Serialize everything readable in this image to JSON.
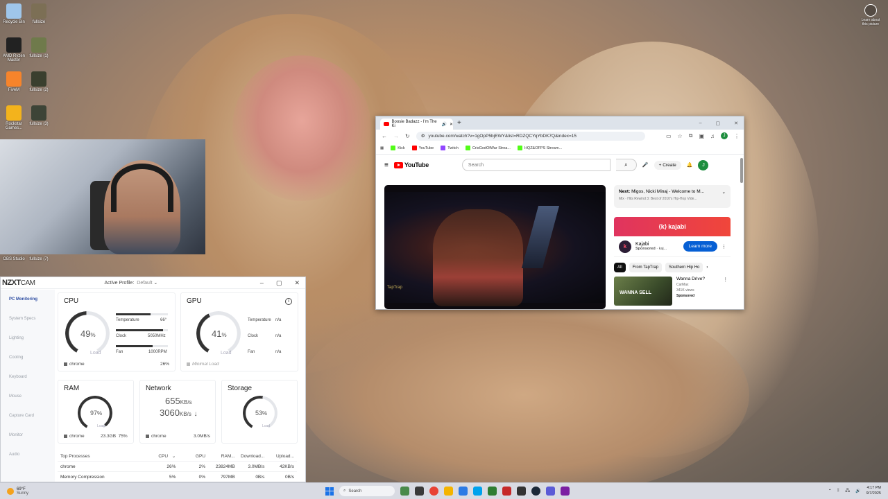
{
  "desktop": {
    "icons": [
      {
        "label": "Recycle Bin",
        "color": "#9fc6ea"
      },
      {
        "label": "fullsize",
        "color": "#7c6f55"
      },
      {
        "label": "AMD Ryzen Master",
        "color": "#222222"
      },
      {
        "label": "fullsize (1)",
        "color": "#6f7a4b"
      },
      {
        "label": "FiveM",
        "color": "#f7842b"
      },
      {
        "label": "fullsize (2)",
        "color": "#3a3f2e"
      },
      {
        "label": "Rockstar Games...",
        "color": "#f3b31c"
      },
      {
        "label": "fullsize (3)",
        "color": "#3d4437"
      },
      {
        "label": "OBS Studio",
        "color": "#2b2b2b"
      },
      {
        "label": "fullsize (7)",
        "color": "#585048"
      }
    ],
    "learn_picture": "Learn about this picture"
  },
  "nzxt": {
    "logo": "NZXT",
    "logo_sub": "CAM",
    "profile_label": "Active Profile:",
    "profile_value": "Default",
    "sidebar": [
      "PC Monitoring",
      "System Specs",
      "Lighting",
      "Cooling",
      "Keyboard",
      "Mouse",
      "Capture Card",
      "Monitor",
      "Audio"
    ],
    "cpu": {
      "title": "CPU",
      "value": "49",
      "unit": "%",
      "load": "Load",
      "level": 0.49,
      "metrics": [
        {
          "label": "Temperature",
          "value": "66°",
          "level": 0.66
        },
        {
          "label": "Clock",
          "value": "5050MHz",
          "level": 0.9
        },
        {
          "label": "Fan",
          "value": "1000RPM",
          "level": 0.7
        }
      ],
      "footer_app": "chrome",
      "footer_value": "26%"
    },
    "gpu": {
      "title": "GPU",
      "value": "41",
      "unit": "%",
      "load": "Load",
      "level": 0.41,
      "metrics": [
        {
          "label": "Temperature",
          "value": "n/a"
        },
        {
          "label": "Clock",
          "value": "n/a"
        },
        {
          "label": "Fan",
          "value": "n/a"
        }
      ],
      "footer_app": "Minimal Load"
    },
    "ram": {
      "title": "RAM",
      "value": "97",
      "unit": "%",
      "load": "Load",
      "level": 0.97,
      "footer_app": "chrome",
      "footer_value": "23.3GB",
      "footer_pct": "75%"
    },
    "network": {
      "title": "Network",
      "down": "655",
      "down_unit": "KB/s",
      "up": "3060",
      "up_unit": "KB/s",
      "footer_app": "chrome",
      "footer_value": "3.0MB/s"
    },
    "storage": {
      "title": "Storage",
      "value": "53",
      "unit": "%",
      "load": "Load",
      "level": 0.53
    },
    "processes": {
      "headers": [
        "Top Processes",
        "CPU",
        "GPU",
        "RAM...",
        "Download...",
        "Upload..."
      ],
      "rows": [
        [
          "chrome",
          "26%",
          "2%",
          "23824MB",
          "3.0MB/s",
          "42KB/s"
        ],
        [
          "Memory Compression",
          "5%",
          "0%",
          "797MB",
          "0B/s",
          "0B/s"
        ]
      ]
    }
  },
  "chrome": {
    "tab_title": "Boosie Badazz - I'm The Ki",
    "url": "youtube.com/watch?v=1gOpP5bjEWY&list=RDZQCYqYbDK7Q&index=15",
    "bookmarks": [
      {
        "label": "Kick",
        "color": "#53fc18"
      },
      {
        "label": "YouTube",
        "color": "#ff0000"
      },
      {
        "label": "Twitch",
        "color": "#9146ff"
      },
      {
        "label": "CrisGodOfWar Strea...",
        "color": "#53fc18"
      },
      {
        "label": "HQZ&OFPS Stream...",
        "color": "#53fc18"
      }
    ],
    "profile_initial": "J"
  },
  "youtube": {
    "logo": "YouTube",
    "search_placeholder": "Search",
    "create": "Create",
    "avatar": "J",
    "watermark": "TapTrap",
    "next_label": "Next:",
    "next_title": "Migos, Nicki Minaj - Welcome to M...",
    "next_sub": "Mix · Hits Rewind 3: Best of 2010's Hip-Hop Vide...",
    "ad_brand_banner": "kajabi",
    "ad_name": "Kajabi",
    "ad_sponsored": "Sponsored",
    "ad_domain": "· kaj...",
    "learn_more": "Learn more",
    "chips": [
      "All",
      "From TapTrap",
      "Southern Hip Ho"
    ],
    "video": {
      "thumb_text": "WANNA SELL",
      "title": "Wanna Drive?",
      "channel": "CarMax",
      "views": "341K views",
      "sponsored": "Sponsored"
    }
  },
  "taskbar": {
    "temp": "69°F",
    "condition": "Sunny",
    "search": "Search",
    "apps": [
      "#4a8a4a",
      "#3a3a3a",
      "#e84335",
      "#f4b400",
      "#2c7be5",
      "#00a2ed",
      "#2e7d32",
      "#c62828",
      "#333333",
      "#1b2838",
      "#5b5bd6",
      "#7b1fa2"
    ],
    "time": "4:17 PM",
    "date": "9/7/2025"
  }
}
